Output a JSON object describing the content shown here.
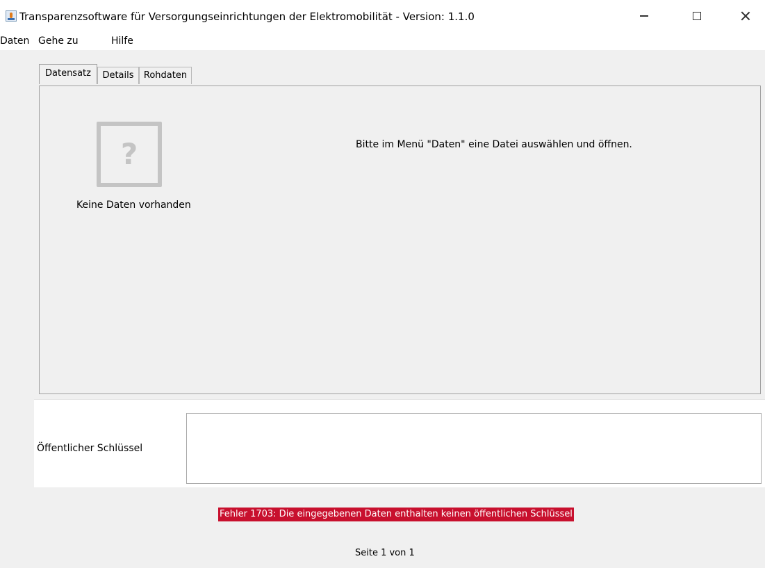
{
  "window": {
    "title": "Transparenzsoftware für Versorgungseinrichtungen der Elektromobilität - Version: 1.1.0"
  },
  "menu": {
    "items": [
      "Daten",
      "Gehe zu",
      "Hilfe"
    ]
  },
  "tabs": [
    {
      "label": "Datensatz",
      "selected": true
    },
    {
      "label": "Details",
      "selected": false
    },
    {
      "label": "Rohdaten",
      "selected": false
    }
  ],
  "panel": {
    "no_data_label": "Keine Daten vorhanden",
    "hint": "Bitte im Menü \"Daten\" eine Datei auswählen und öffnen.",
    "icon": "question-mark-icon"
  },
  "public_key": {
    "label": "Öffentlicher Schlüssel",
    "value": ""
  },
  "status": {
    "error": "Fehler 1703: Die eingegebenen Daten enthalten keinen öffentlichen Schlüssel",
    "error_bg": "#c8102e",
    "page_info": "Seite 1 von 1"
  }
}
